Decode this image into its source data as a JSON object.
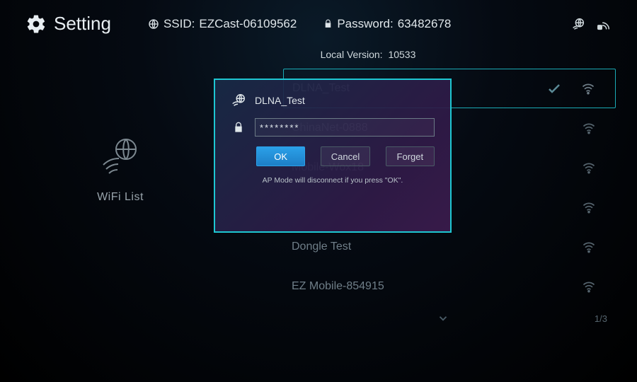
{
  "header": {
    "title": "Setting",
    "ssid_label": "SSID:",
    "ssid_value": "EZCast-06109562",
    "password_label": "Password:",
    "password_value": "63482678"
  },
  "version": {
    "label": "Local Version:",
    "value": "10533"
  },
  "sidebar": {
    "label": "WiFi List"
  },
  "networks": [
    {
      "name": "DLNA_Test",
      "connected": true
    },
    {
      "name": "ChinaNet-0888",
      "connected": false
    },
    {
      "name": "Mobile-Wox18",
      "connected": false
    },
    {
      "name": "",
      "connected": false
    },
    {
      "name": "Dongle Test",
      "connected": false
    },
    {
      "name": "EZ Mobile-854915",
      "connected": false
    }
  ],
  "pagination": "1/3",
  "modal": {
    "network_name": "DLNA_Test",
    "password_mask": "********",
    "ok_label": "OK",
    "cancel_label": "Cancel",
    "forget_label": "Forget",
    "note": "AP Mode will disconnect if you press \"OK\"."
  }
}
